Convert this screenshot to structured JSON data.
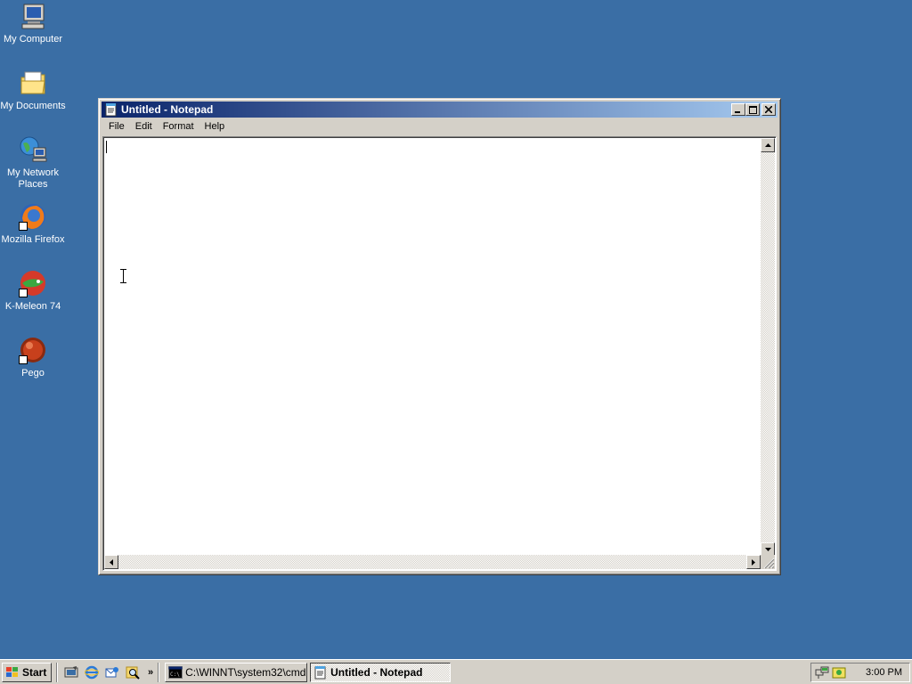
{
  "desktop": {
    "icons": [
      {
        "label": "My Computer",
        "icon": "computer-icon"
      },
      {
        "label": "My Documents",
        "icon": "folder-icon"
      },
      {
        "label": "My Network Places",
        "icon": "network-icon"
      },
      {
        "label": "Mozilla Firefox",
        "icon": "firefox-icon"
      },
      {
        "label": "K-Meleon 74",
        "icon": "kmeleon-icon"
      },
      {
        "label": "Pego",
        "icon": "pego-icon"
      }
    ]
  },
  "window": {
    "title": "Untitled - Notepad",
    "buttons": {
      "minimize": "minimize-icon",
      "maximize": "maximize-icon",
      "close": "close-icon"
    },
    "menu": [
      "File",
      "Edit",
      "Format",
      "Help"
    ],
    "content": ""
  },
  "taskbar": {
    "start_label": "Start",
    "quick_launch": [
      "show-desktop-icon",
      "internet-explorer-icon",
      "outlook-express-icon",
      "search-icon"
    ],
    "chevron": "»",
    "tasks": [
      {
        "label": "C:\\WINNT\\system32\\cmd...",
        "icon": "cmd-icon",
        "active": false
      },
      {
        "label": "Untitled - Notepad",
        "icon": "notepad-icon",
        "active": true
      }
    ],
    "clock": "3:00 PM"
  },
  "colors": {
    "desktop": "#3a6ea5",
    "titlebar_start": "#0a246a",
    "titlebar_end": "#a6caf0",
    "face": "#d4d0c8"
  }
}
